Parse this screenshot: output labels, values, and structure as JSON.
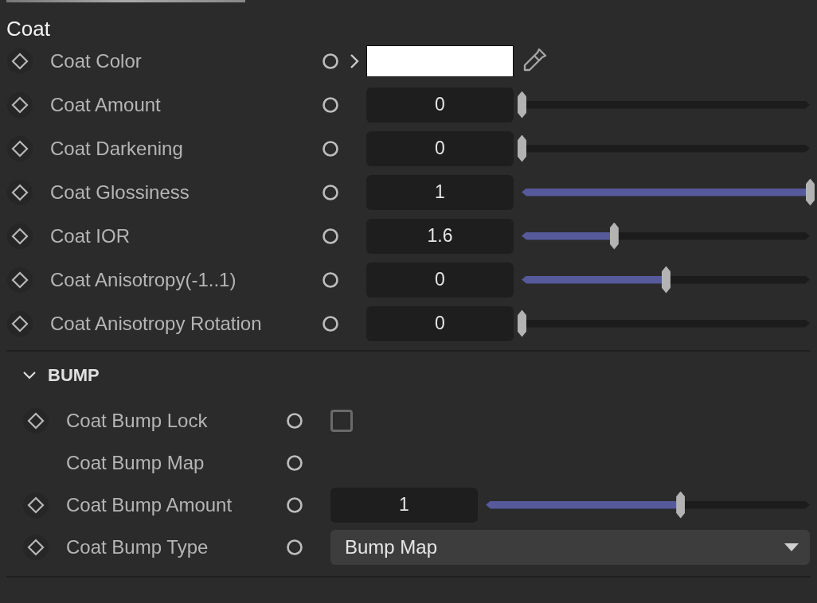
{
  "section_title": "Coat",
  "coat_rows": [
    {
      "kind": "color",
      "label": "Coat Color",
      "color": "#ffffff"
    },
    {
      "kind": "slider",
      "label": "Coat Amount",
      "value": "0",
      "level": 0
    },
    {
      "kind": "slider",
      "label": "Coat Darkening",
      "value": "0",
      "level": 0
    },
    {
      "kind": "slider",
      "label": "Coat Glossiness",
      "value": "1",
      "level": 1
    },
    {
      "kind": "slider",
      "label": "Coat IOR",
      "value": "1.6",
      "level": 0.32
    },
    {
      "kind": "slider",
      "label": "Coat Anisotropy(-1..1)",
      "value": "0",
      "level": 0.5
    },
    {
      "kind": "slider",
      "label": "Coat Anisotropy Rotation",
      "value": "0",
      "level": 0
    }
  ],
  "bump": {
    "title": "BUMP",
    "expanded": true,
    "rows": [
      {
        "kind": "checkbox",
        "label": "Coat Bump Lock",
        "keyframe": true,
        "checked": false
      },
      {
        "kind": "none",
        "label": "Coat Bump Map",
        "keyframe": false
      },
      {
        "kind": "slider",
        "label": "Coat Bump Amount",
        "keyframe": true,
        "value": "1",
        "level": 0.6
      },
      {
        "kind": "dropdown",
        "label": "Coat Bump Type",
        "keyframe": true,
        "value": "Bump Map"
      }
    ]
  }
}
